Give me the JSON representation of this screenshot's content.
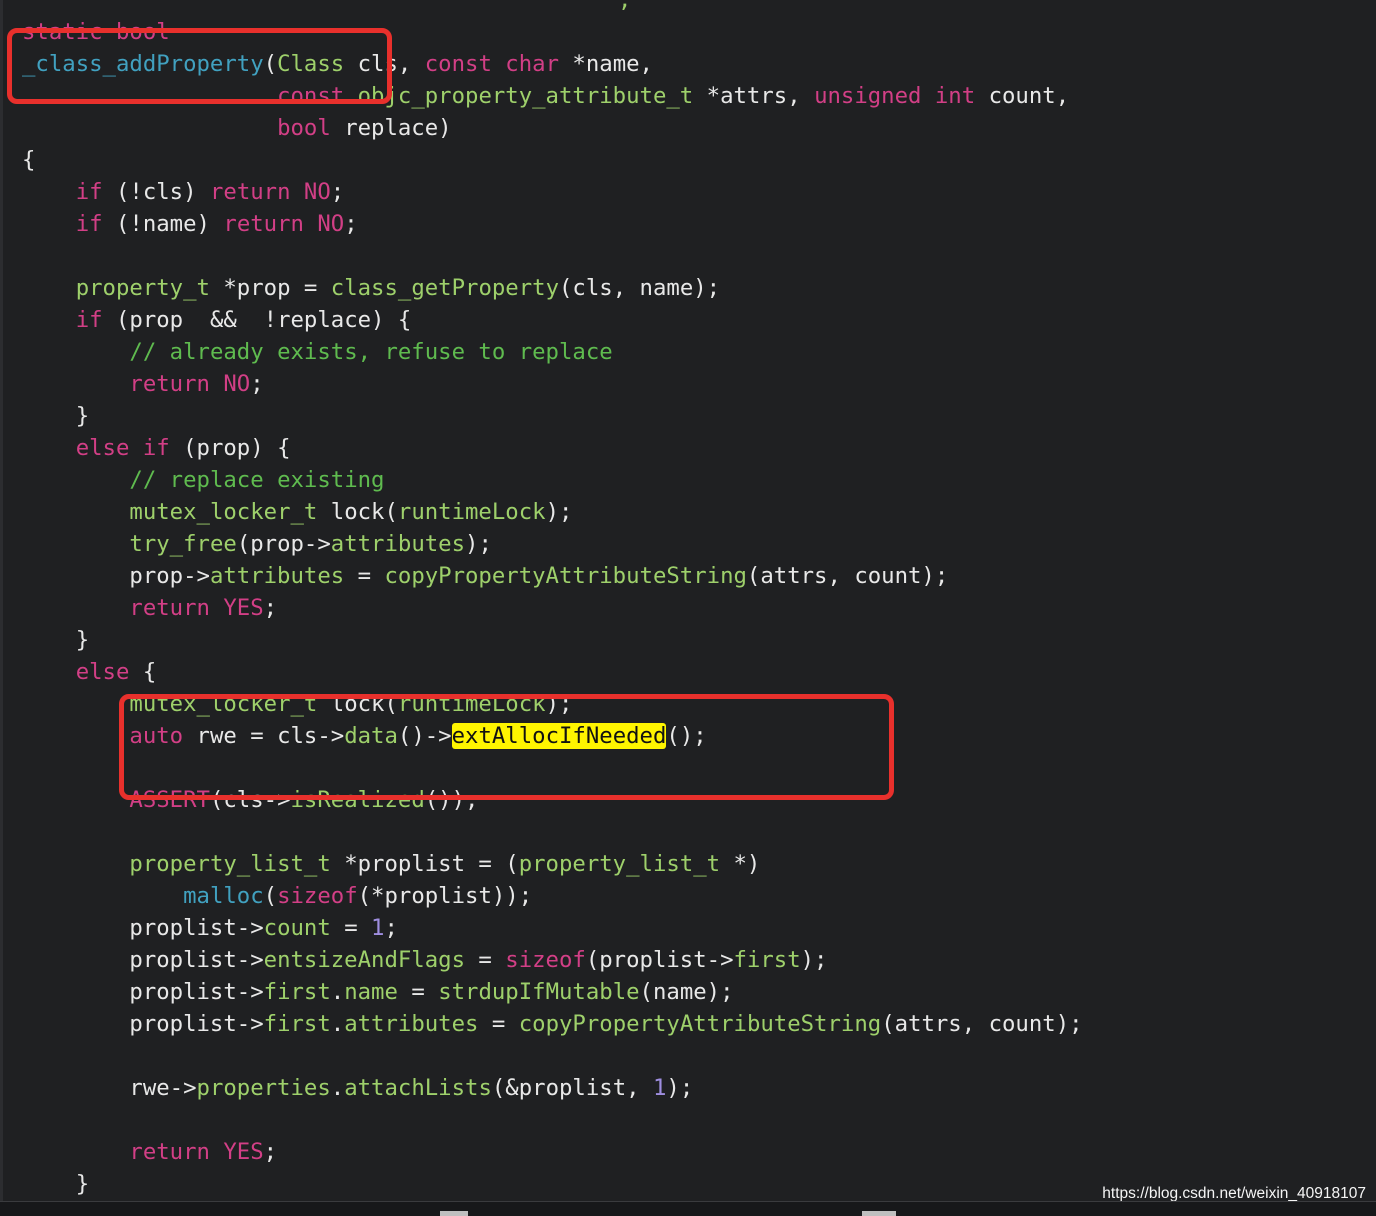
{
  "code": {
    "top_cut": ";",
    "lines": [
      [
        [
          "k",
          "static bool"
        ]
      ],
      [
        [
          "f",
          "_class_addProperty"
        ],
        [
          "p",
          "("
        ],
        [
          "t",
          "Class"
        ],
        [
          "p",
          " cls, "
        ],
        [
          "k",
          "const char"
        ],
        [
          "p",
          " *name,"
        ]
      ],
      [
        [
          "p",
          "                   "
        ],
        [
          "k",
          "const"
        ],
        [
          "p",
          " "
        ],
        [
          "t",
          "objc_property_attribute_t"
        ],
        [
          "p",
          " *attrs, "
        ],
        [
          "k",
          "unsigned int"
        ],
        [
          "p",
          " count,"
        ]
      ],
      [
        [
          "p",
          "                   "
        ],
        [
          "k",
          "bool"
        ],
        [
          "p",
          " replace)"
        ]
      ],
      [
        [
          "p",
          "{"
        ]
      ],
      [
        [
          "p",
          "    "
        ],
        [
          "k",
          "if"
        ],
        [
          "p",
          " (!cls) "
        ],
        [
          "k",
          "return NO"
        ],
        [
          "p",
          ";"
        ]
      ],
      [
        [
          "p",
          "    "
        ],
        [
          "k",
          "if"
        ],
        [
          "p",
          " (!name) "
        ],
        [
          "k",
          "return NO"
        ],
        [
          "p",
          ";"
        ]
      ],
      [],
      [
        [
          "p",
          "    "
        ],
        [
          "t",
          "property_t"
        ],
        [
          "p",
          " *prop = "
        ],
        [
          "t",
          "class_getProperty"
        ],
        [
          "p",
          "(cls, name);"
        ]
      ],
      [
        [
          "p",
          "    "
        ],
        [
          "k",
          "if"
        ],
        [
          "p",
          " (prop  &&  !replace) {"
        ]
      ],
      [
        [
          "p",
          "        "
        ],
        [
          "c",
          "// already exists, refuse to replace"
        ]
      ],
      [
        [
          "p",
          "        "
        ],
        [
          "k",
          "return NO"
        ],
        [
          "p",
          ";"
        ]
      ],
      [
        [
          "p",
          "    }"
        ]
      ],
      [
        [
          "p",
          "    "
        ],
        [
          "k",
          "else if"
        ],
        [
          "p",
          " (prop) {"
        ]
      ],
      [
        [
          "p",
          "        "
        ],
        [
          "c",
          "// replace existing"
        ]
      ],
      [
        [
          "p",
          "        "
        ],
        [
          "t",
          "mutex_locker_t"
        ],
        [
          "p",
          " lock("
        ],
        [
          "t",
          "runtimeLock"
        ],
        [
          "p",
          ");"
        ]
      ],
      [
        [
          "p",
          "        "
        ],
        [
          "t",
          "try_free"
        ],
        [
          "p",
          "(prop->"
        ],
        [
          "t",
          "attributes"
        ],
        [
          "p",
          ");"
        ]
      ],
      [
        [
          "p",
          "        prop->"
        ],
        [
          "t",
          "attributes"
        ],
        [
          "p",
          " = "
        ],
        [
          "t",
          "copyPropertyAttributeString"
        ],
        [
          "p",
          "(attrs, count);"
        ]
      ],
      [
        [
          "p",
          "        "
        ],
        [
          "k",
          "return YES"
        ],
        [
          "p",
          ";"
        ]
      ],
      [
        [
          "p",
          "    }"
        ]
      ],
      [
        [
          "p",
          "    "
        ],
        [
          "k",
          "else"
        ],
        [
          "p",
          " {"
        ]
      ],
      [
        [
          "p",
          "        "
        ],
        [
          "t",
          "mutex_locker_t"
        ],
        [
          "p",
          " lock("
        ],
        [
          "t",
          "runtimeLock"
        ],
        [
          "p",
          ");"
        ]
      ],
      [
        [
          "p",
          "        "
        ],
        [
          "k",
          "auto"
        ],
        [
          "p",
          " rwe = cls->"
        ],
        [
          "t",
          "data"
        ],
        [
          "p",
          "()->"
        ],
        [
          "hl",
          "extAllocIfNeeded"
        ],
        [
          "p",
          "();"
        ]
      ],
      [],
      [
        [
          "p",
          "        "
        ],
        [
          "k",
          "ASSERT"
        ],
        [
          "p",
          "(cls->"
        ],
        [
          "t",
          "isRealized"
        ],
        [
          "p",
          "());"
        ]
      ],
      [],
      [
        [
          "p",
          "        "
        ],
        [
          "t",
          "property_list_t"
        ],
        [
          "p",
          " *proplist = ("
        ],
        [
          "t",
          "property_list_t"
        ],
        [
          "p",
          " *)"
        ]
      ],
      [
        [
          "p",
          "            "
        ],
        [
          "f",
          "malloc"
        ],
        [
          "p",
          "("
        ],
        [
          "k",
          "sizeof"
        ],
        [
          "p",
          "(*proplist));"
        ]
      ],
      [
        [
          "p",
          "        proplist->"
        ],
        [
          "t",
          "count"
        ],
        [
          "p",
          " = "
        ],
        [
          "n",
          "1"
        ],
        [
          "p",
          ";"
        ]
      ],
      [
        [
          "p",
          "        proplist->"
        ],
        [
          "t",
          "entsizeAndFlags"
        ],
        [
          "p",
          " = "
        ],
        [
          "k",
          "sizeof"
        ],
        [
          "p",
          "(proplist->"
        ],
        [
          "t",
          "first"
        ],
        [
          "p",
          ");"
        ]
      ],
      [
        [
          "p",
          "        proplist->"
        ],
        [
          "t",
          "first"
        ],
        [
          "p",
          "."
        ],
        [
          "t",
          "name"
        ],
        [
          "p",
          " = "
        ],
        [
          "t",
          "strdupIfMutable"
        ],
        [
          "p",
          "(name);"
        ]
      ],
      [
        [
          "p",
          "        proplist->"
        ],
        [
          "t",
          "first"
        ],
        [
          "p",
          "."
        ],
        [
          "t",
          "attributes"
        ],
        [
          "p",
          " = "
        ],
        [
          "t",
          "copyPropertyAttributeString"
        ],
        [
          "p",
          "(attrs, count);"
        ]
      ],
      [],
      [
        [
          "p",
          "        rwe->"
        ],
        [
          "t",
          "properties"
        ],
        [
          "p",
          "."
        ],
        [
          "t",
          "attachLists"
        ],
        [
          "p",
          "(&proplist, "
        ],
        [
          "n",
          "1"
        ],
        [
          "p",
          ");"
        ]
      ],
      [],
      [
        [
          "p",
          "        "
        ],
        [
          "k",
          "return YES"
        ],
        [
          "p",
          ";"
        ]
      ],
      [
        [
          "p",
          "    }"
        ]
      ]
    ]
  },
  "colors": {
    "background": "#1f2022",
    "keyword": "#d23f86",
    "type": "#9ed06b",
    "function": "#41a1c0",
    "comment": "#5fbb4f",
    "number": "#9f8ee0",
    "plain": "#e8e8e8",
    "highlight": "#fff500",
    "annotation_box": "#e8302c"
  },
  "watermark": "https://blog.csdn.net/weixin_40918107"
}
